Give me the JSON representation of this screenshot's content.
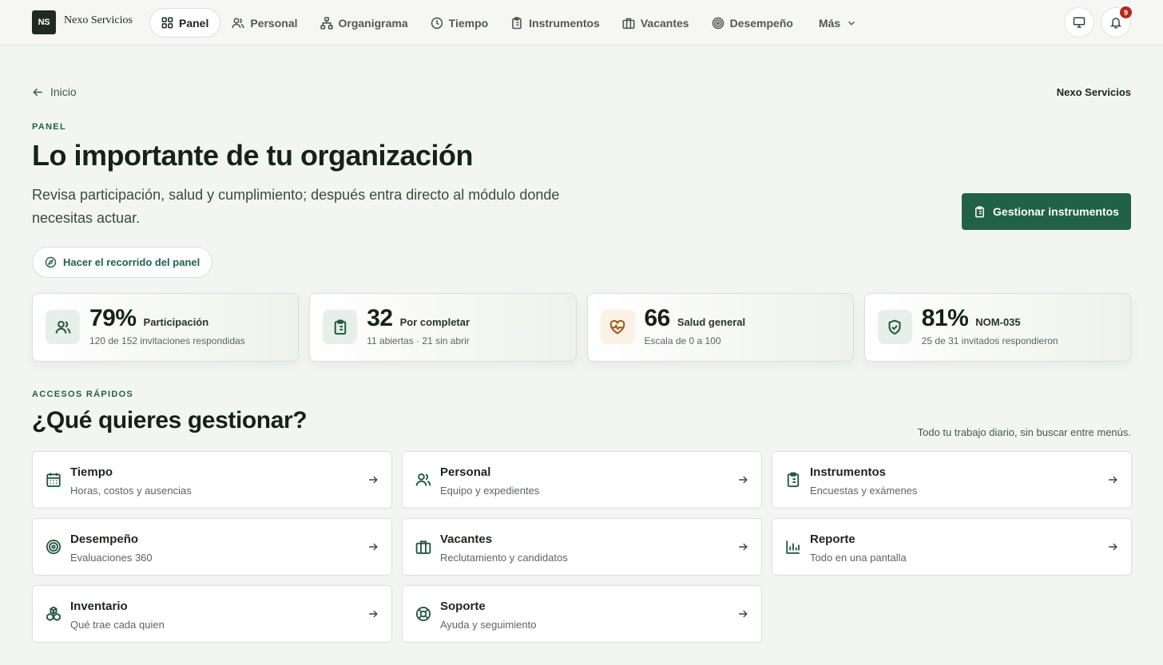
{
  "app": {
    "logo_initials": "NS",
    "brand_name": "Nexo Servicios"
  },
  "nav": {
    "items": [
      {
        "label": "Panel",
        "icon": "grid-icon",
        "active": true
      },
      {
        "label": "Personal",
        "icon": "users-icon"
      },
      {
        "label": "Organigrama",
        "icon": "org-chart-icon"
      },
      {
        "label": "Tiempo",
        "icon": "clock-icon"
      },
      {
        "label": "Instrumentos",
        "icon": "clipboard-icon"
      },
      {
        "label": "Vacantes",
        "icon": "briefcase-icon"
      },
      {
        "label": "Desempeño",
        "icon": "target-icon"
      }
    ],
    "more_label": "Más",
    "notifications_count": "9"
  },
  "header": {
    "back_label": "Inicio",
    "org_name": "Nexo Servicios",
    "eyebrow": "PANEL",
    "title": "Lo importante de tu organización",
    "description": "Revisa participación, salud y cumplimiento; después entra directo al módulo donde necesitas actuar.",
    "primary_button": "Gestionar instrumentos",
    "tour_button": "Hacer el recorrido del panel"
  },
  "stats": [
    {
      "value": "79%",
      "label": "Participación",
      "sub": "120 de 152 invitaciones respondidas",
      "icon": "users-icon",
      "tone": "green"
    },
    {
      "value": "32",
      "label": "Por completar",
      "sub": "11 abiertas · 21 sin abrir",
      "icon": "clipboard-icon",
      "tone": "green"
    },
    {
      "value": "66",
      "label": "Salud general",
      "sub": "Escala de 0 a 100",
      "icon": "heart-pulse-icon",
      "tone": "orange"
    },
    {
      "value": "81%",
      "label": "NOM-035",
      "sub": "25 de 31 invitados respondieron",
      "icon": "shield-check-icon",
      "tone": "green"
    }
  ],
  "quick": {
    "eyebrow": "ACCESOS RÁPIDOS",
    "title": "¿Qué quieres gestionar?",
    "note": "Todo tu trabajo diario, sin buscar entre menús.",
    "tiles": [
      {
        "title": "Tiempo",
        "sub": "Horas, costos y ausencias",
        "icon": "calendar-icon"
      },
      {
        "title": "Personal",
        "sub": "Equipo y expedientes",
        "icon": "users-icon"
      },
      {
        "title": "Instrumentos",
        "sub": "Encuestas y exámenes",
        "icon": "clipboard-icon"
      },
      {
        "title": "Desempeño",
        "sub": "Evaluaciones 360",
        "icon": "target-icon"
      },
      {
        "title": "Vacantes",
        "sub": "Reclutamiento y candidatos",
        "icon": "briefcase-icon"
      },
      {
        "title": "Reporte",
        "sub": "Todo en una pantalla",
        "icon": "bar-chart-icon"
      },
      {
        "title": "Inventario",
        "sub": "Qué trae cada quien",
        "icon": "boxes-icon"
      },
      {
        "title": "Soporte",
        "sub": "Ayuda y seguimiento",
        "icon": "lifebuoy-icon"
      }
    ]
  },
  "colors": {
    "accent": "#226149",
    "background": "#f3f5f2",
    "badge": "#b5271c",
    "orange_tone": "#fbf1e4",
    "green_tone": "#e7efea"
  }
}
